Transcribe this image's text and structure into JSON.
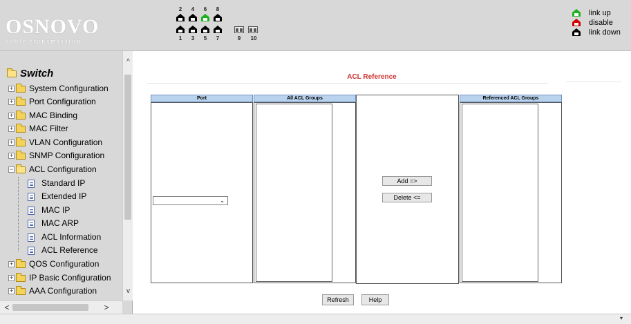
{
  "brand": {
    "name": "OSNOVO",
    "tagline": "cable transmission"
  },
  "ports": {
    "top_numbers": [
      "2",
      "4",
      "6",
      "8"
    ],
    "bottom_numbers": [
      "1",
      "3",
      "5",
      "7"
    ],
    "fiber_numbers": [
      "9",
      "10"
    ],
    "link_up_ports": [
      "6"
    ]
  },
  "legend": {
    "link_up": "link up",
    "disable": "disable",
    "link_down": "link down"
  },
  "colors": {
    "link_up": "#1bb21b",
    "disable": "#d00000",
    "link_down": "#000000",
    "title": "#cc3333",
    "column_header": "#b9d3ee"
  },
  "sidebar": {
    "root": "Switch",
    "items": [
      {
        "label": "System Configuration",
        "expanded": false
      },
      {
        "label": "Port Configuration",
        "expanded": false
      },
      {
        "label": "MAC Binding",
        "expanded": false
      },
      {
        "label": "MAC Filter",
        "expanded": false
      },
      {
        "label": "VLAN Configuration",
        "expanded": false
      },
      {
        "label": "SNMP Configuration",
        "expanded": false
      },
      {
        "label": "ACL Configuration",
        "expanded": true
      },
      {
        "label": "QOS Configuration",
        "expanded": false
      },
      {
        "label": "IP Basic Configuration",
        "expanded": false
      },
      {
        "label": "AAA Configuration",
        "expanded": false
      }
    ],
    "acl_children": [
      "Standard IP",
      "Extended IP",
      "MAC IP",
      "MAC ARP",
      "ACL Information",
      "ACL Reference"
    ],
    "expander_collapsed": "+",
    "expander_expanded": "−",
    "scroll_up": "^",
    "scroll_down": "v",
    "scroll_left": "<",
    "scroll_right": ">"
  },
  "main": {
    "title": "ACL Reference",
    "columns": {
      "port": "Port",
      "all_groups": "All ACL Groups",
      "referenced": "Referenced ACL Groups"
    },
    "port_select": {
      "value": "",
      "caret": "⌄"
    },
    "buttons": {
      "add": "Add =>",
      "delete": "Delete <=",
      "refresh": "Refresh",
      "help": "Help"
    }
  },
  "footer": {
    "caret": "▾"
  }
}
